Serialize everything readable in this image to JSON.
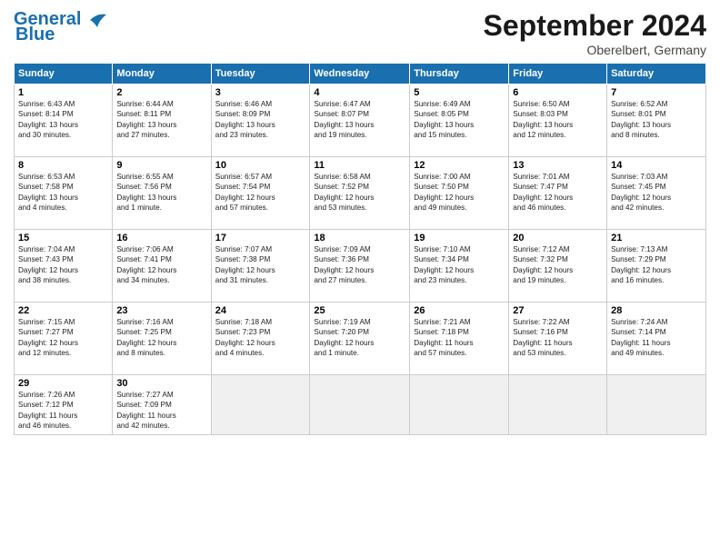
{
  "header": {
    "logo_line1": "General",
    "logo_line2": "Blue",
    "month_title": "September 2024",
    "location": "Oberelbert, Germany"
  },
  "weekdays": [
    "Sunday",
    "Monday",
    "Tuesday",
    "Wednesday",
    "Thursday",
    "Friday",
    "Saturday"
  ],
  "days": [
    {
      "num": "",
      "info": ""
    },
    {
      "num": "",
      "info": ""
    },
    {
      "num": "",
      "info": ""
    },
    {
      "num": "",
      "info": ""
    },
    {
      "num": "",
      "info": ""
    },
    {
      "num": "",
      "info": ""
    },
    {
      "num": "",
      "info": ""
    },
    {
      "num": "1",
      "info": "Sunrise: 6:43 AM\nSunset: 8:14 PM\nDaylight: 13 hours\nand 30 minutes."
    },
    {
      "num": "2",
      "info": "Sunrise: 6:44 AM\nSunset: 8:11 PM\nDaylight: 13 hours\nand 27 minutes."
    },
    {
      "num": "3",
      "info": "Sunrise: 6:46 AM\nSunset: 8:09 PM\nDaylight: 13 hours\nand 23 minutes."
    },
    {
      "num": "4",
      "info": "Sunrise: 6:47 AM\nSunset: 8:07 PM\nDaylight: 13 hours\nand 19 minutes."
    },
    {
      "num": "5",
      "info": "Sunrise: 6:49 AM\nSunset: 8:05 PM\nDaylight: 13 hours\nand 15 minutes."
    },
    {
      "num": "6",
      "info": "Sunrise: 6:50 AM\nSunset: 8:03 PM\nDaylight: 13 hours\nand 12 minutes."
    },
    {
      "num": "7",
      "info": "Sunrise: 6:52 AM\nSunset: 8:01 PM\nDaylight: 13 hours\nand 8 minutes."
    },
    {
      "num": "8",
      "info": "Sunrise: 6:53 AM\nSunset: 7:58 PM\nDaylight: 13 hours\nand 4 minutes."
    },
    {
      "num": "9",
      "info": "Sunrise: 6:55 AM\nSunset: 7:56 PM\nDaylight: 13 hours\nand 1 minute."
    },
    {
      "num": "10",
      "info": "Sunrise: 6:57 AM\nSunset: 7:54 PM\nDaylight: 12 hours\nand 57 minutes."
    },
    {
      "num": "11",
      "info": "Sunrise: 6:58 AM\nSunset: 7:52 PM\nDaylight: 12 hours\nand 53 minutes."
    },
    {
      "num": "12",
      "info": "Sunrise: 7:00 AM\nSunset: 7:50 PM\nDaylight: 12 hours\nand 49 minutes."
    },
    {
      "num": "13",
      "info": "Sunrise: 7:01 AM\nSunset: 7:47 PM\nDaylight: 12 hours\nand 46 minutes."
    },
    {
      "num": "14",
      "info": "Sunrise: 7:03 AM\nSunset: 7:45 PM\nDaylight: 12 hours\nand 42 minutes."
    },
    {
      "num": "15",
      "info": "Sunrise: 7:04 AM\nSunset: 7:43 PM\nDaylight: 12 hours\nand 38 minutes."
    },
    {
      "num": "16",
      "info": "Sunrise: 7:06 AM\nSunset: 7:41 PM\nDaylight: 12 hours\nand 34 minutes."
    },
    {
      "num": "17",
      "info": "Sunrise: 7:07 AM\nSunset: 7:38 PM\nDaylight: 12 hours\nand 31 minutes."
    },
    {
      "num": "18",
      "info": "Sunrise: 7:09 AM\nSunset: 7:36 PM\nDaylight: 12 hours\nand 27 minutes."
    },
    {
      "num": "19",
      "info": "Sunrise: 7:10 AM\nSunset: 7:34 PM\nDaylight: 12 hours\nand 23 minutes."
    },
    {
      "num": "20",
      "info": "Sunrise: 7:12 AM\nSunset: 7:32 PM\nDaylight: 12 hours\nand 19 minutes."
    },
    {
      "num": "21",
      "info": "Sunrise: 7:13 AM\nSunset: 7:29 PM\nDaylight: 12 hours\nand 16 minutes."
    },
    {
      "num": "22",
      "info": "Sunrise: 7:15 AM\nSunset: 7:27 PM\nDaylight: 12 hours\nand 12 minutes."
    },
    {
      "num": "23",
      "info": "Sunrise: 7:16 AM\nSunset: 7:25 PM\nDaylight: 12 hours\nand 8 minutes."
    },
    {
      "num": "24",
      "info": "Sunrise: 7:18 AM\nSunset: 7:23 PM\nDaylight: 12 hours\nand 4 minutes."
    },
    {
      "num": "25",
      "info": "Sunrise: 7:19 AM\nSunset: 7:20 PM\nDaylight: 12 hours\nand 1 minute."
    },
    {
      "num": "26",
      "info": "Sunrise: 7:21 AM\nSunset: 7:18 PM\nDaylight: 11 hours\nand 57 minutes."
    },
    {
      "num": "27",
      "info": "Sunrise: 7:22 AM\nSunset: 7:16 PM\nDaylight: 11 hours\nand 53 minutes."
    },
    {
      "num": "28",
      "info": "Sunrise: 7:24 AM\nSunset: 7:14 PM\nDaylight: 11 hours\nand 49 minutes."
    },
    {
      "num": "29",
      "info": "Sunrise: 7:26 AM\nSunset: 7:12 PM\nDaylight: 11 hours\nand 46 minutes."
    },
    {
      "num": "30",
      "info": "Sunrise: 7:27 AM\nSunset: 7:09 PM\nDaylight: 11 hours\nand 42 minutes."
    },
    {
      "num": "",
      "info": ""
    },
    {
      "num": "",
      "info": ""
    },
    {
      "num": "",
      "info": ""
    },
    {
      "num": "",
      "info": ""
    },
    {
      "num": "",
      "info": ""
    }
  ]
}
